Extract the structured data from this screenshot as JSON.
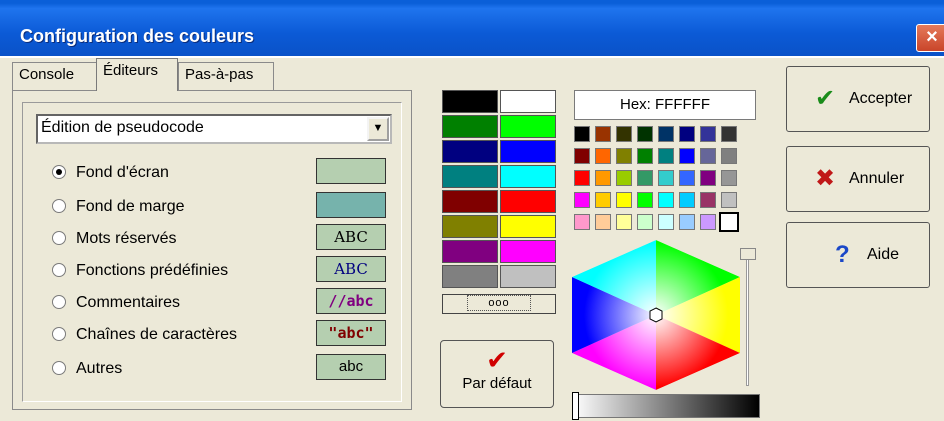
{
  "window": {
    "title": "Configuration des couleurs",
    "close_glyph": "×"
  },
  "tabs": [
    {
      "label": "Console"
    },
    {
      "label": "Éditeurs"
    },
    {
      "label": "Pas-à-pas"
    }
  ],
  "editor_select": {
    "value": "Édition de pseudocode"
  },
  "options": [
    {
      "label": "Fond d'écran",
      "checked": true,
      "swatch": {
        "text": "",
        "bg": "#b5cfb0",
        "fg": "#000000"
      }
    },
    {
      "label": "Fond de marge",
      "checked": false,
      "swatch": {
        "text": "",
        "bg": "#76b3ac",
        "fg": "#000000"
      }
    },
    {
      "label": "Mots réservés",
      "checked": false,
      "swatch": {
        "text": "ABC",
        "bg": "#b5cfb0",
        "fg": "#000000"
      }
    },
    {
      "label": "Fonctions prédéfinies",
      "checked": false,
      "swatch": {
        "text": "ABC",
        "bg": "#b5cfb0",
        "fg": "#000080"
      }
    },
    {
      "label": "Commentaires",
      "checked": false,
      "swatch": {
        "text": "//abc",
        "bg": "#b5cfb0",
        "fg": "#800080"
      }
    },
    {
      "label": "Chaînes de caractères",
      "checked": false,
      "swatch": {
        "text": "\"abc\"",
        "bg": "#b5cfb0",
        "fg": "#800000"
      }
    },
    {
      "label": "Autres",
      "checked": false,
      "swatch": {
        "text": "abc",
        "bg": "#b5cfb0",
        "fg": "#000000"
      }
    }
  ],
  "palette": [
    [
      "#000000",
      "#ffffff"
    ],
    [
      "#008000",
      "#00ff00"
    ],
    [
      "#000080",
      "#0000ff"
    ],
    [
      "#008080",
      "#00ffff"
    ],
    [
      "#800000",
      "#ff0000"
    ],
    [
      "#808000",
      "#ffff00"
    ],
    [
      "#800080",
      "#ff00ff"
    ],
    [
      "#808080",
      "#c0c0c0"
    ]
  ],
  "more_colors_label": "ooo",
  "default_button": {
    "icon": "red-check-icon",
    "label": "Par défaut"
  },
  "hex_display": "Hex: FFFFFF",
  "mini_palette": [
    [
      "#000000",
      "#993300",
      "#333300",
      "#003300",
      "#003366",
      "#000080",
      "#333399",
      "#333333"
    ],
    [
      "#800000",
      "#ff6600",
      "#808000",
      "#008000",
      "#008080",
      "#0000ff",
      "#666699",
      "#808080"
    ],
    [
      "#ff0000",
      "#ff9900",
      "#99cc00",
      "#339966",
      "#33cccc",
      "#3366ff",
      "#800080",
      "#969696"
    ],
    [
      "#ff00ff",
      "#ffcc00",
      "#ffff00",
      "#00ff00",
      "#00ffff",
      "#00ccff",
      "#993366",
      "#c0c0c0"
    ],
    [
      "#ff99cc",
      "#ffcc99",
      "#ffff99",
      "#ccffcc",
      "#ccffff",
      "#99ccff",
      "#cc99ff",
      "#ffffff"
    ]
  ],
  "buttons": {
    "accept": {
      "label": "Accepter",
      "icon": "green-check-icon"
    },
    "cancel": {
      "label": "Annuler",
      "icon": "red-x-icon"
    },
    "help": {
      "label": "Aide",
      "icon": "question-icon"
    }
  }
}
